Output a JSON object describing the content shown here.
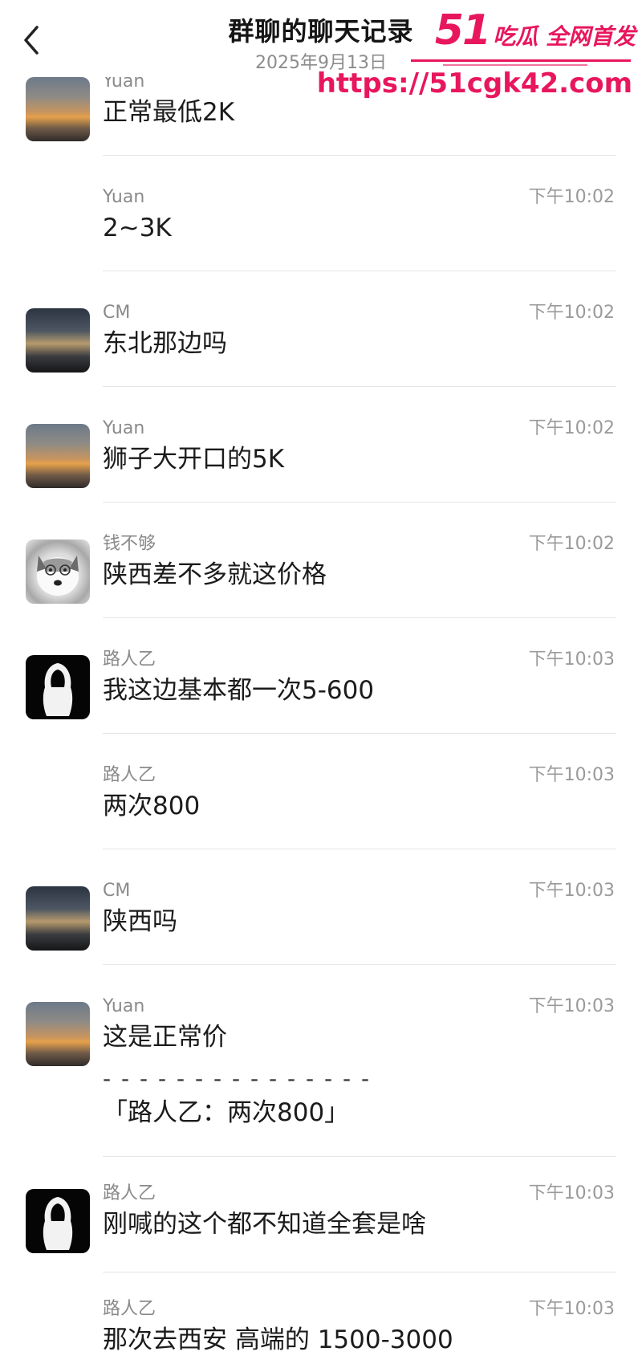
{
  "header": {
    "title": "群聊的聊天记录",
    "date": "2025年9月13日"
  },
  "watermark": {
    "number": "51",
    "text": "吃瓜 全网首发",
    "url": "https://51cgk42.com"
  },
  "icons": {
    "back": "chevron-left-icon"
  },
  "messages": [
    {
      "sender": "Yuan",
      "time": "",
      "text": "正常最低2K",
      "avatar": "sunset"
    },
    {
      "sender": "Yuan",
      "time": "下午10:02",
      "text": "2~3K",
      "avatar": ""
    },
    {
      "sender": "CM",
      "time": "下午10:02",
      "text": "东北那边吗",
      "avatar": "city"
    },
    {
      "sender": "Yuan",
      "time": "下午10:02",
      "text": "狮子大开口的5K",
      "avatar": "sunset"
    },
    {
      "sender": "钱不够",
      "time": "下午10:02",
      "text": "陕西差不多就这价格",
      "avatar": "dog"
    },
    {
      "sender": "路人乙",
      "time": "下午10:03",
      "text": "我这边基本都一次5-600",
      "avatar": "shadow"
    },
    {
      "sender": "路人乙",
      "time": "下午10:03",
      "text": "两次800",
      "avatar": ""
    },
    {
      "sender": "CM",
      "time": "下午10:03",
      "text": "陕西吗",
      "avatar": "city"
    },
    {
      "sender": "Yuan",
      "time": "下午10:03",
      "text": "这是正常价",
      "avatar": "sunset",
      "quote_separator": "- - - - - - - - - - - - - - -",
      "quote": "「路人乙：两次800」"
    },
    {
      "sender": "路人乙",
      "time": "下午10:03",
      "text": "刚喊的这个都不知道全套是啥",
      "avatar": "shadow"
    },
    {
      "sender": "路人乙",
      "time": "下午10:03",
      "text": "那次去西安  高端的  1500-3000",
      "avatar": ""
    }
  ]
}
